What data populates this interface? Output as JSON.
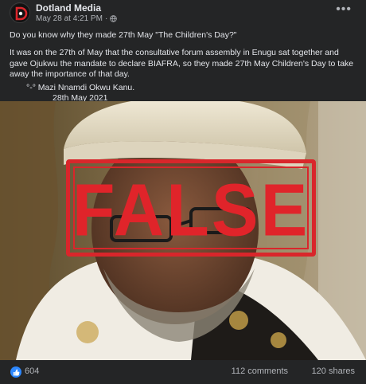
{
  "post": {
    "page_name": "Dotland Media",
    "timestamp": "May 28 at 4:21 PM",
    "separator": "·",
    "more_icon": "more-horizontal-icon",
    "audience_icon": "globe-icon",
    "body": {
      "question": "Do you know why they made 27th May \"The Children's Day?\"",
      "paragraph": " It was on the 27th of May that the consultative forum assembly in Enugu sat together and gave Ojukwu the mandate to declare BIAFRA, so they made 27th May Children's Day to take away the importance of that day.",
      "signature": "°-° Mazi Nnamdi Okwu Kanu.",
      "date": "28th May 2021"
    },
    "image": {
      "stamp_text": "FALSE",
      "stamp_color": "#e0242a"
    },
    "reactions": {
      "like_icon": "thumbs-up-icon",
      "like_color": "#2d88ff",
      "count": "604",
      "comments": "112 comments",
      "shares": "120 shares"
    }
  },
  "colors": {
    "background": "#242526",
    "primary_text": "#e4e6eb",
    "secondary_text": "#b0b3b8"
  }
}
